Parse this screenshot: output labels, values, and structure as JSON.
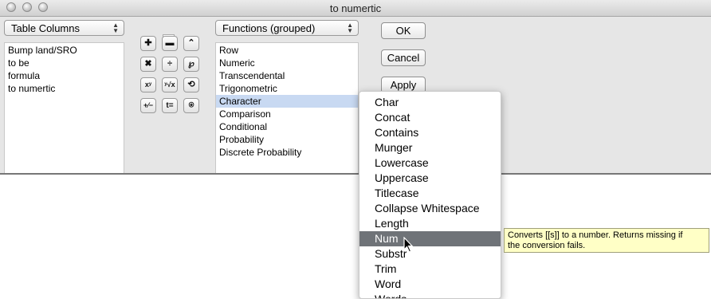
{
  "window": {
    "title": "to numertic"
  },
  "columns_popup": {
    "selected": "Table Columns"
  },
  "columns_list": [
    "Bump land/SRO",
    "to be",
    "formula",
    "to numertic"
  ],
  "functions_popup": {
    "selected": "Functions (grouped)"
  },
  "function_groups": [
    "Row",
    "Numeric",
    "Transcendental",
    "Trigonometric",
    "Character",
    "Comparison",
    "Conditional",
    "Probability",
    "Discrete Probability"
  ],
  "selected_group": "Character",
  "buttons": {
    "ok": "OK",
    "cancel": "Cancel",
    "apply": "Apply"
  },
  "operators": [
    {
      "name": "plus-icon",
      "glyph": "✚"
    },
    {
      "name": "minus-icon",
      "glyph": "▬"
    },
    {
      "name": "caret-up-icon",
      "glyph": "⌃"
    },
    {
      "name": "multiply-icon",
      "glyph": "✖"
    },
    {
      "name": "divide-icon",
      "glyph": "÷"
    },
    {
      "name": "root-icon",
      "glyph": "℘"
    },
    {
      "name": "power-icon",
      "glyph": "xʸ"
    },
    {
      "name": "nth-root-icon",
      "glyph": "ʸ√x"
    },
    {
      "name": "swap-icon",
      "glyph": "⟲"
    },
    {
      "name": "negate-icon",
      "glyph": "+⁄−"
    },
    {
      "name": "assign-icon",
      "glyph": "t="
    },
    {
      "name": "peel-icon",
      "glyph": "⍟"
    }
  ],
  "character_functions": [
    "Char",
    "Concat",
    "Contains",
    "Munger",
    "Lowercase",
    "Uppercase",
    "Titlecase",
    "Collapse Whitespace",
    "Length",
    "Num",
    "Substr",
    "Trim",
    "Word",
    "Words"
  ],
  "highlighted_function": "Num",
  "tooltip": {
    "line1": "Converts [[s]] to a number. Returns missing if",
    "line2": "the conversion fails."
  }
}
